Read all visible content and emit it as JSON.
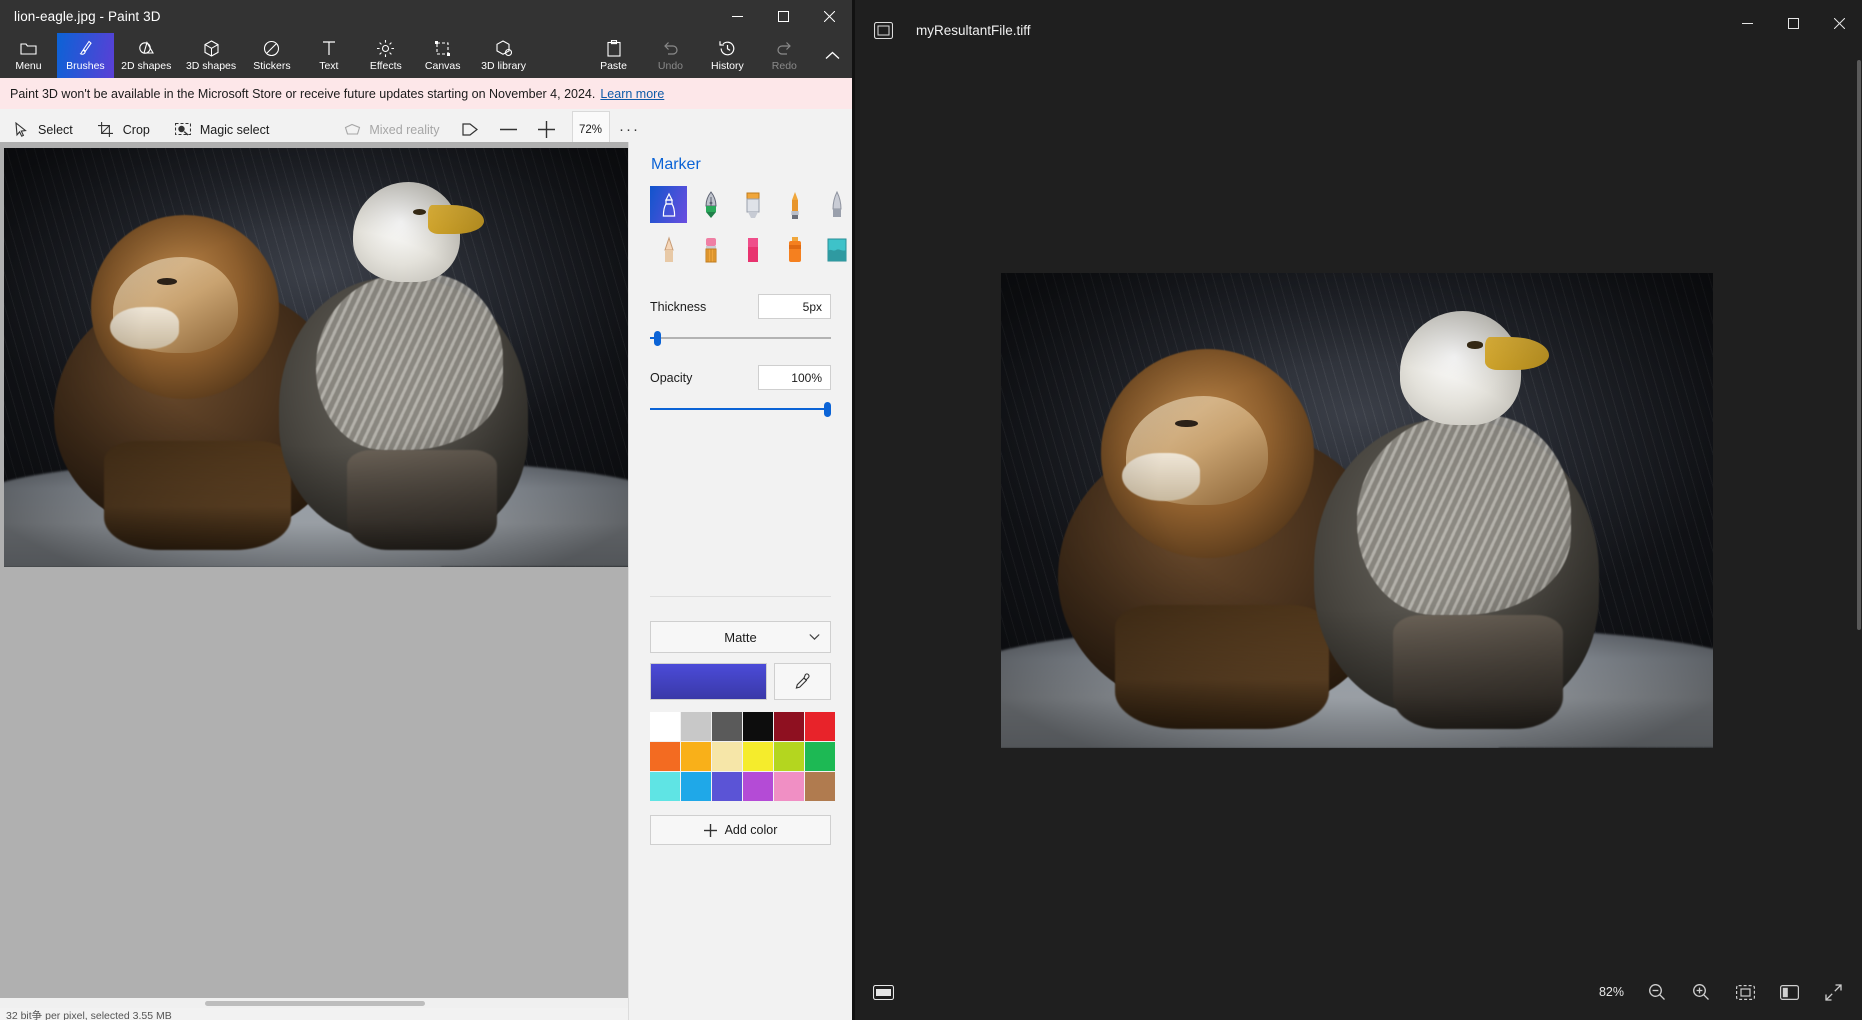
{
  "paint3d": {
    "title": "lion-eagle.jpg - Paint 3D",
    "window_buttons": [
      {
        "name": "minimize",
        "glyph": "─"
      },
      {
        "name": "maximize",
        "glyph": "☐"
      },
      {
        "name": "close",
        "glyph": "✕"
      }
    ],
    "ribbon": [
      {
        "label": "Menu",
        "icon": "folder-icon",
        "state": "normal"
      },
      {
        "label": "Brushes",
        "icon": "brush-icon",
        "state": "active"
      },
      {
        "label": "2D shapes",
        "icon": "2d-shapes-icon",
        "state": "normal"
      },
      {
        "label": "3D shapes",
        "icon": "3d-shapes-icon",
        "state": "normal"
      },
      {
        "label": "Stickers",
        "icon": "stickers-icon",
        "state": "normal"
      },
      {
        "label": "Text",
        "icon": "text-icon",
        "state": "normal"
      },
      {
        "label": "Effects",
        "icon": "effects-icon",
        "state": "normal"
      },
      {
        "label": "Canvas",
        "icon": "canvas-icon",
        "state": "normal"
      },
      {
        "label": "3D library",
        "icon": "3d-library-icon",
        "state": "normal"
      },
      {
        "label": "Paste",
        "icon": "paste-icon",
        "state": "normal"
      },
      {
        "label": "Undo",
        "icon": "undo-icon",
        "state": "disabled"
      },
      {
        "label": "History",
        "icon": "history-icon",
        "state": "normal"
      },
      {
        "label": "Redo",
        "icon": "redo-icon",
        "state": "disabled"
      }
    ],
    "banner": {
      "text": "Paint 3D won't be available in the Microsoft Store or receive future updates starting on November 4, 2024.",
      "link": "Learn more"
    },
    "toolbar": {
      "select": "Select",
      "crop": "Crop",
      "magic_select": "Magic select",
      "mixed_reality": "Mixed reality",
      "zoom_value": "72%",
      "more": "···"
    },
    "panel": {
      "title": "Marker",
      "brushes": [
        {
          "name": "marker",
          "selected": true
        },
        {
          "name": "calligraphy-pen",
          "selected": false
        },
        {
          "name": "calligraphy-brush",
          "selected": false
        },
        {
          "name": "oil-brush",
          "selected": false
        },
        {
          "name": "watercolor",
          "selected": false
        },
        {
          "name": "pixel-pen",
          "selected": false
        },
        {
          "name": "pencil",
          "selected": false
        },
        {
          "name": "eraser",
          "selected": false
        },
        {
          "name": "crayon",
          "selected": false
        },
        {
          "name": "fill",
          "selected": false
        }
      ],
      "thickness_label": "Thickness",
      "thickness_value": "5px",
      "thickness_percent": 4,
      "opacity_label": "Opacity",
      "opacity_value": "100%",
      "opacity_percent": 98,
      "material_label": "Matte",
      "current_color": "#4b4bd8",
      "eyedropper": "eyedropper-icon",
      "swatches": [
        "#ffffff",
        "#c8c8c8",
        "#5a5a5a",
        "#0d0d0d",
        "#8e1020",
        "#e8232a",
        "#f36b21",
        "#f9b019",
        "#f6e6a8",
        "#f5ec2c",
        "#b4d61f",
        "#1db954",
        "#5fe4e4",
        "#1fa8e8",
        "#5b54d6",
        "#b44bd6",
        "#f08fc4",
        "#b07b4f"
      ],
      "add_color": "Add color",
      "add_color_icon": "plus-icon"
    },
    "status_bar": "32 bit争 per pixel, selected 3.55 MB"
  },
  "photos": {
    "filename": "myResultantFile.tiff",
    "left_icons": [
      {
        "name": "collection-icon",
        "glyph": "⊞"
      }
    ],
    "center_icons": [
      {
        "name": "edit-image-icon"
      },
      {
        "name": "rotate-icon"
      },
      {
        "name": "delete-icon"
      },
      {
        "name": "favorite-icon"
      },
      {
        "name": "info-icon"
      },
      {
        "name": "print-icon"
      },
      {
        "name": "onedrive-icon"
      },
      {
        "name": "designer-icon"
      },
      {
        "name": "see-more-icon"
      }
    ],
    "window_buttons": [
      {
        "name": "minimize",
        "glyph": "─"
      },
      {
        "name": "maximize",
        "glyph": "☐"
      },
      {
        "name": "close",
        "glyph": "✕"
      }
    ],
    "bottom": {
      "filmstrip_icon": "filmstrip-icon",
      "zoom_value": "82%",
      "zoom_out_icon": "zoom-out-icon",
      "zoom_in_icon": "zoom-in-icon",
      "fit_icon": "fit-to-window-icon",
      "actual_size_icon": "actual-size-icon",
      "fullscreen_icon": "fullscreen-icon"
    }
  }
}
